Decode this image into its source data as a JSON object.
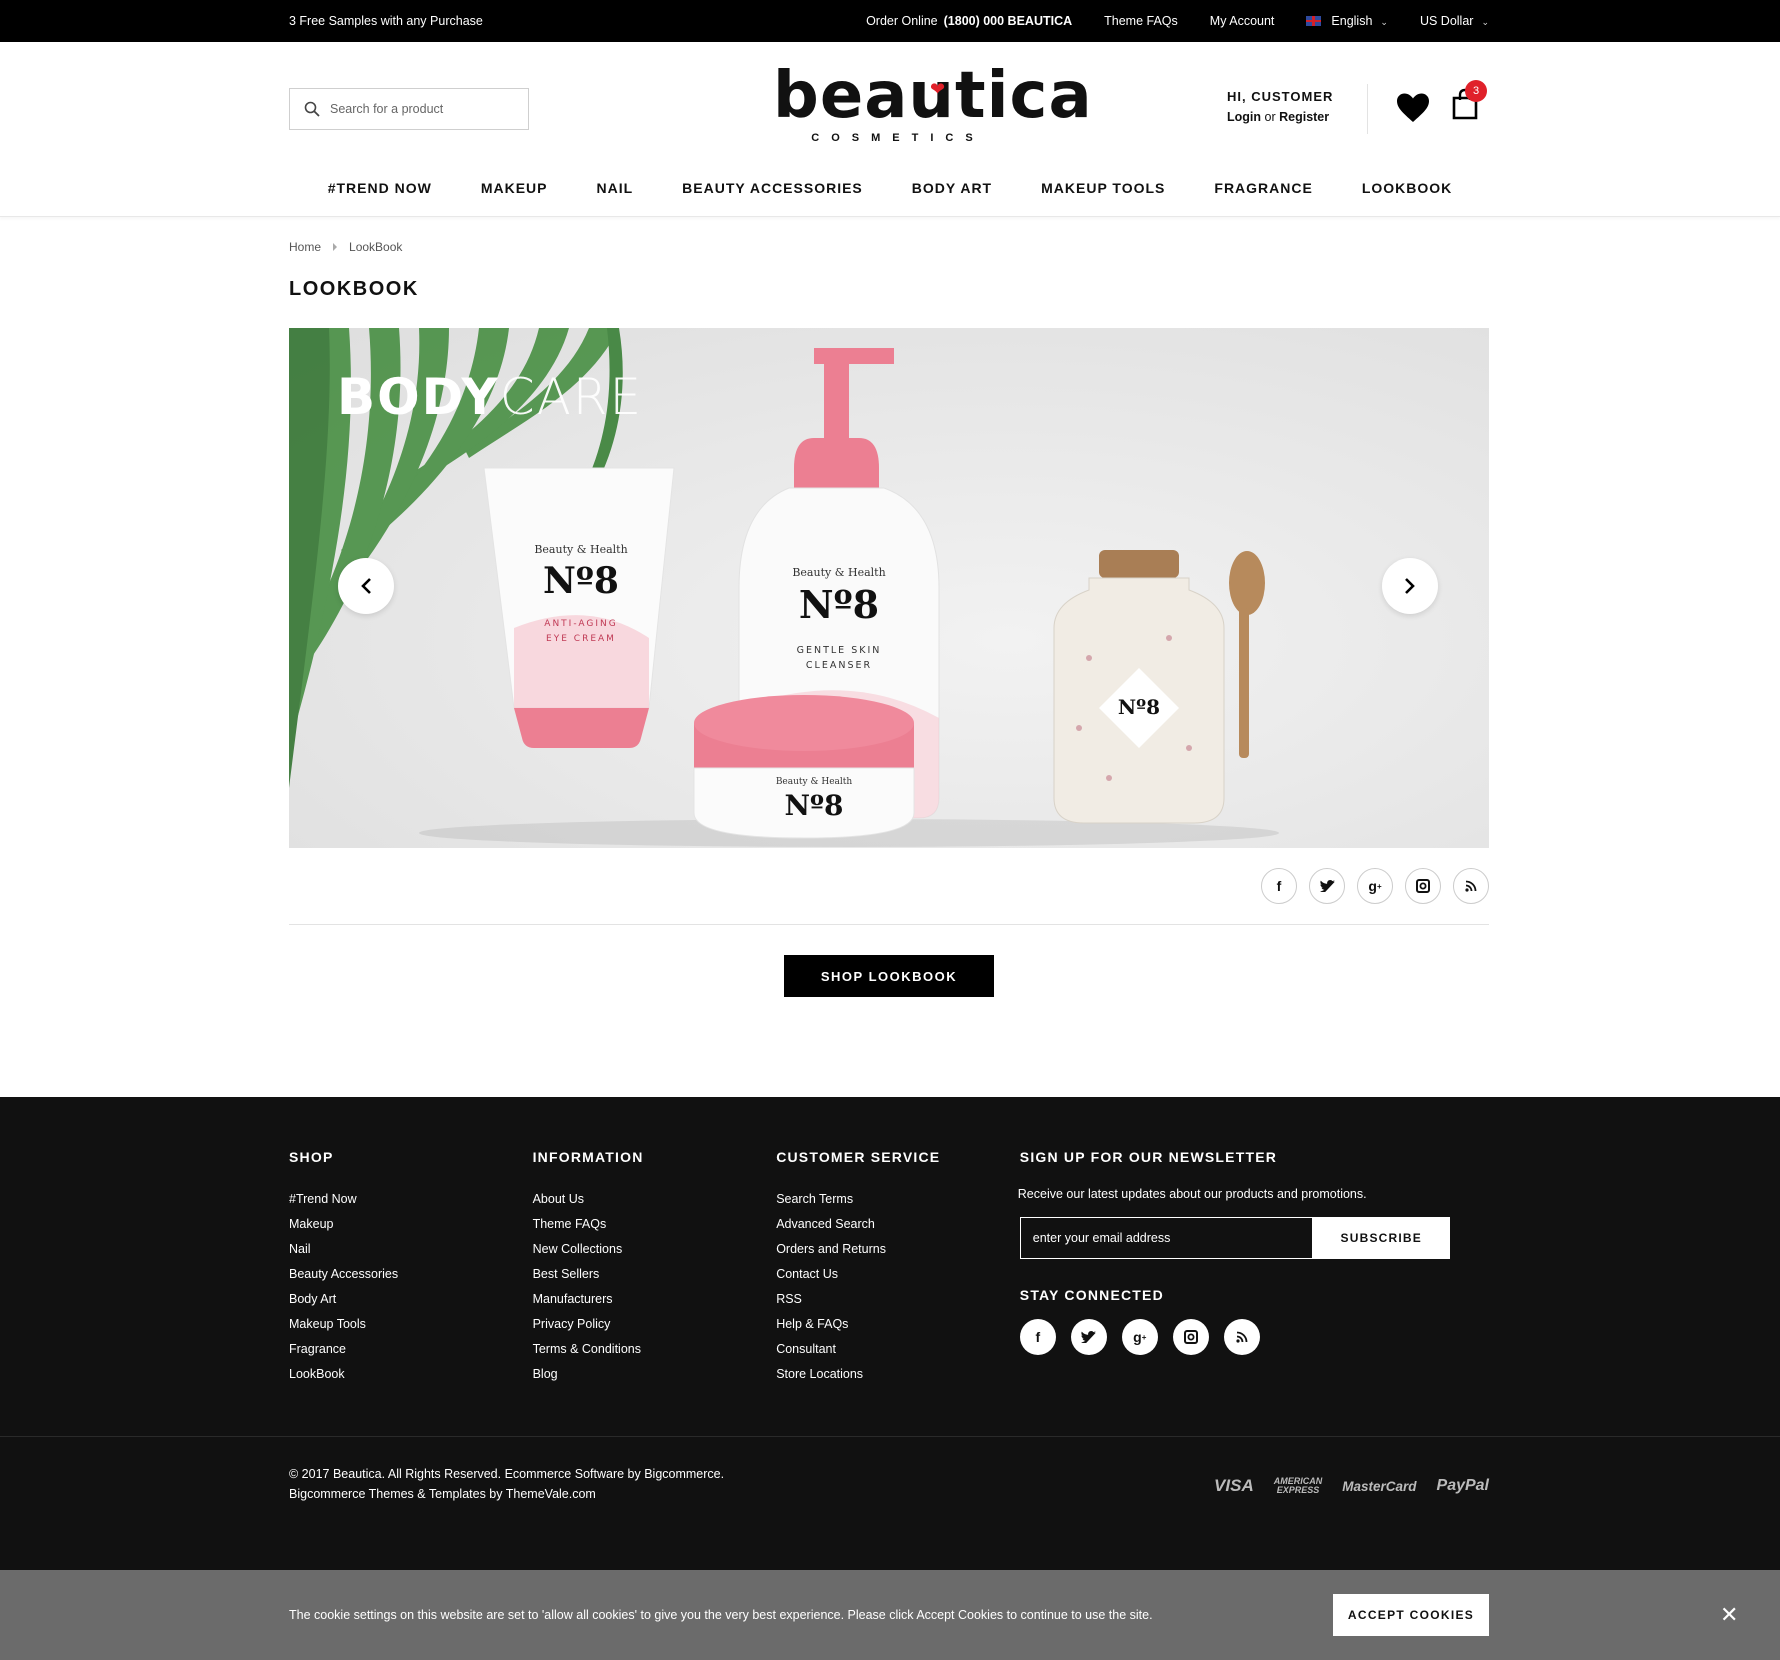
{
  "topbar": {
    "promo": "3 Free Samples with any Purchase",
    "order_label": "Order Online",
    "order_phone": "(1800) 000 BEAUTICA",
    "faqs": "Theme FAQs",
    "account": "My Account",
    "language": "English",
    "currency": "US Dollar"
  },
  "header": {
    "search_placeholder": "Search for a product",
    "logo_word": "beautica",
    "logo_sub": "COSMETICS",
    "greeting": "HI, CUSTOMER",
    "login": "Login",
    "or": "or",
    "register": "Register",
    "cart_count": "3"
  },
  "nav": [
    "#TREND NOW",
    "MAKEUP",
    "NAIL",
    "BEAUTY ACCESSORIES",
    "BODY ART",
    "MAKEUP TOOLS",
    "FRAGRANCE",
    "LOOKBOOK"
  ],
  "breadcrumb": {
    "home": "Home",
    "current": "LookBook"
  },
  "page_title": "LOOKBOOK",
  "banner": {
    "title_bold": "BODY",
    "title_light": "CARE"
  },
  "shop_button": "SHOP LOOKBOOK",
  "footer": {
    "shop": {
      "title": "SHOP",
      "items": [
        "#Trend Now",
        "Makeup",
        "Nail",
        "Beauty Accessories",
        "Body Art",
        "Makeup Tools",
        "Fragrance",
        "LookBook"
      ]
    },
    "information": {
      "title": "INFORMATION",
      "items": [
        "About Us",
        "Theme FAQs",
        "New Collections",
        "Best Sellers",
        "Manufacturers",
        "Privacy Policy",
        "Terms & Conditions",
        "Blog"
      ]
    },
    "service": {
      "title": "CUSTOMER SERVICE",
      "items": [
        "Search Terms",
        "Advanced Search",
        "Orders and Returns",
        "Contact Us",
        "RSS",
        "Help & FAQs",
        "Consultant",
        "Store Locations"
      ]
    },
    "newsletter": {
      "title": "SIGN UP FOR OUR NEWSLETTER",
      "text": "Receive our latest updates about our products and promotions.",
      "placeholder": "enter your email address",
      "button": "SUBSCRIBE",
      "connected": "STAY CONNECTED"
    },
    "copyright_1": "© 2017 Beautica. All Rights Reserved. Ecommerce Software by Bigcommerce.",
    "copyright_2": "Bigcommerce Themes & Templates by ThemeVale.com",
    "payments": {
      "visa": "VISA",
      "amex_1": "AMERICAN",
      "amex_2": "EXPRESS",
      "mastercard": "MasterCard",
      "paypal": "PayPal"
    }
  },
  "cookie": {
    "text": "The cookie settings on this website are set to 'allow all cookies' to give you the very best experience. Please click Accept Cookies to continue to use the site.",
    "button": "ACCEPT COOKIES"
  },
  "colors": {
    "accent": "#e0212a",
    "footer_bg": "#111111",
    "cookie_bg": "#6b6b6b",
    "pink": "#ec7f92"
  },
  "icons": [
    "search-icon",
    "heart-icon",
    "bag-icon",
    "chevron-left-icon",
    "chevron-right-icon",
    "facebook-icon",
    "twitter-icon",
    "google-plus-icon",
    "instagram-icon",
    "rss-icon",
    "close-icon"
  ]
}
